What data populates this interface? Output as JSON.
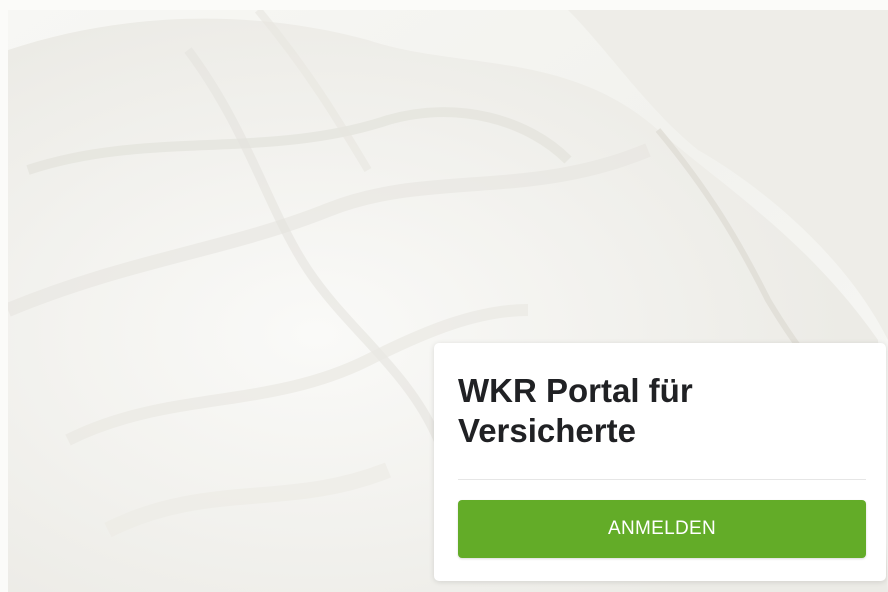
{
  "card": {
    "title": "WKR Portal für Versicherte",
    "login_button_label": "ANMELDEN"
  },
  "colors": {
    "button_green": "#63ac28",
    "title_text": "#202124",
    "card_background": "#ffffff"
  }
}
